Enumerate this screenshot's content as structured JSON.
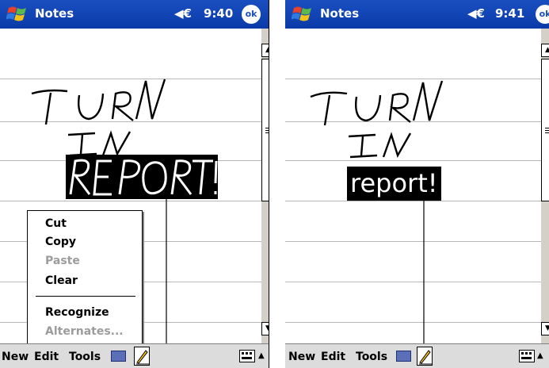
{
  "left_screen": {
    "app_title": "Notes",
    "speaker_glyph": "◀€",
    "time": "9:40",
    "ok_label": "ok",
    "context_menu": {
      "cut": "Cut",
      "copy": "Copy",
      "paste": "Paste",
      "clear": "Clear",
      "recognize": "Recognize",
      "alternates": "Alternates..."
    },
    "menu": {
      "new": "New",
      "edit": "Edit",
      "tools": "Tools"
    }
  },
  "right_screen": {
    "app_title": "Notes",
    "speaker_glyph": "◀€",
    "time": "9:41",
    "ok_label": "ok",
    "recognized_text": "report!",
    "menu": {
      "new": "New",
      "edit": "Edit",
      "tools": "Tools"
    }
  },
  "icons": {
    "start_flag": "windows-flag-icon",
    "speaker": "speaker-icon",
    "keyboard": "keyboard-icon",
    "pen": "pen-icon",
    "sip": "sip-keyboard-icon"
  },
  "colors": {
    "titlebar": "#1a4fc0",
    "menubar": "#dcdcdc",
    "ruling": "#b8b8b8",
    "scroll_track": "#d4d0c8"
  }
}
